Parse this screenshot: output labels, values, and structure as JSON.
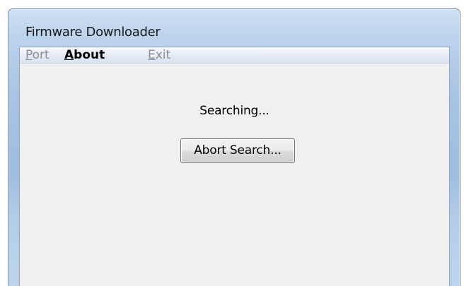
{
  "window": {
    "title": "Firmware Downloader"
  },
  "menu": {
    "items": [
      {
        "label_accel": "P",
        "label_rest": "ort",
        "enabled": false
      },
      {
        "label_accel": "A",
        "label_rest": "bout",
        "enabled": true
      },
      {
        "label_accel": "E",
        "label_rest": "xit",
        "enabled": false
      }
    ]
  },
  "main": {
    "status": "Searching...",
    "abort_button_label": "Abort Search..."
  }
}
